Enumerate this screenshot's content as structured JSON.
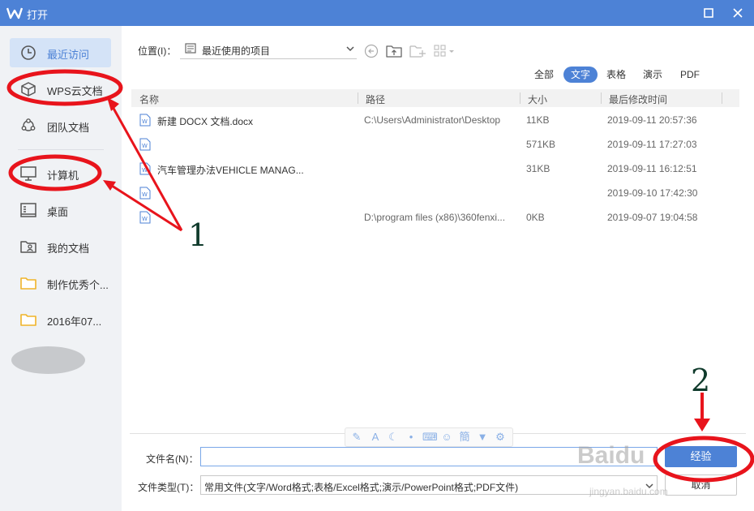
{
  "window": {
    "title": "打开",
    "accent": "#4d82d6"
  },
  "sidebar": {
    "items": [
      {
        "label": "最近访问",
        "icon": "clock-icon",
        "active": true
      },
      {
        "label": "WPS云文档",
        "icon": "cloud-box-icon"
      },
      {
        "label": "团队文档",
        "icon": "team-icon"
      },
      {
        "label": "计算机",
        "icon": "monitor-icon"
      },
      {
        "label": "桌面",
        "icon": "desktop-icon"
      },
      {
        "label": "我的文档",
        "icon": "user-folder-icon"
      },
      {
        "label": "制作优秀个...",
        "icon": "folder-icon"
      },
      {
        "label": "2016年07...",
        "icon": "folder-icon"
      }
    ]
  },
  "location": {
    "label": "位置(I)：",
    "value": "最近使用的项目"
  },
  "filters": {
    "all": "全部",
    "text": "文字",
    "sheet": "表格",
    "present": "演示",
    "pdf": "PDF"
  },
  "table": {
    "headers": {
      "name": "名称",
      "path": "路径",
      "size": "大小",
      "modified": "最后修改时间"
    },
    "rows": [
      {
        "name": "新建 DOCX 文档.docx",
        "path": "C:\\Users\\Administrator\\Desktop",
        "size": "11KB",
        "modified": "2019-09-11 20:57:36"
      },
      {
        "name": "",
        "path": "",
        "size": "571KB",
        "modified": "2019-09-11 17:27:03"
      },
      {
        "name": "汽车管理办法VEHICLE MANAG...",
        "path": "",
        "size": "31KB",
        "modified": "2019-09-11 16:12:51"
      },
      {
        "name": "",
        "path": "",
        "size": "",
        "modified": "2019-09-10 17:42:30"
      },
      {
        "name": "",
        "path": "D:\\program files (x86)\\360fenxi...",
        "size": "0KB",
        "modified": "2019-09-07 19:04:58"
      }
    ]
  },
  "footer": {
    "filename_label": "文件名(N)：",
    "filename_value": "",
    "filetype_label": "文件类型(T)：",
    "filetype_value": "常用文件(文字/Word格式;表格/Excel格式;演示/PowerPoint格式;PDF文件)",
    "open_label": "经验",
    "cancel_label": "取消"
  },
  "annotations": {
    "step1": "1",
    "step2": "2",
    "color": "#e8141c"
  },
  "watermark": {
    "brand": "Baidu",
    "site": "jingyan.baidu.com"
  }
}
